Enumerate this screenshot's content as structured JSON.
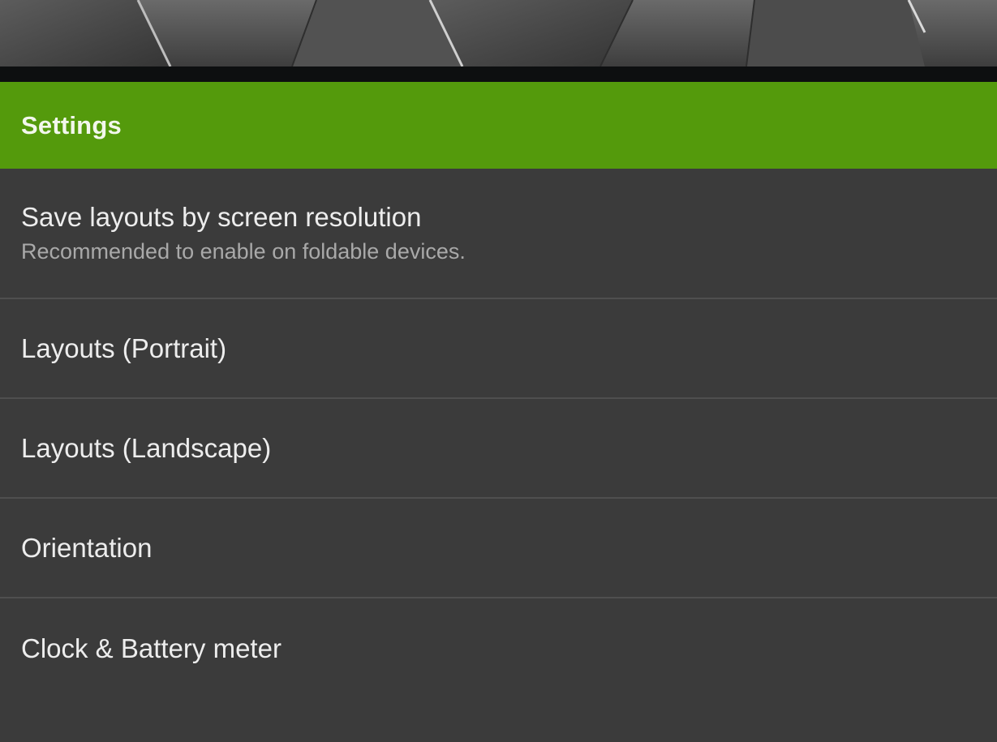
{
  "header": {
    "title": "Settings"
  },
  "items": [
    {
      "title": "Save layouts by screen resolution",
      "subtitle": "Recommended to enable on foldable devices."
    },
    {
      "title": "Layouts (Portrait)"
    },
    {
      "title": "Layouts (Landscape)"
    },
    {
      "title": "Orientation"
    },
    {
      "title": "Clock & Battery meter"
    }
  ],
  "colors": {
    "header_bg": "#549a0c",
    "list_bg": "#3b3b3b",
    "divider": "#4f4f4f",
    "section_header": "#c7a64a"
  }
}
